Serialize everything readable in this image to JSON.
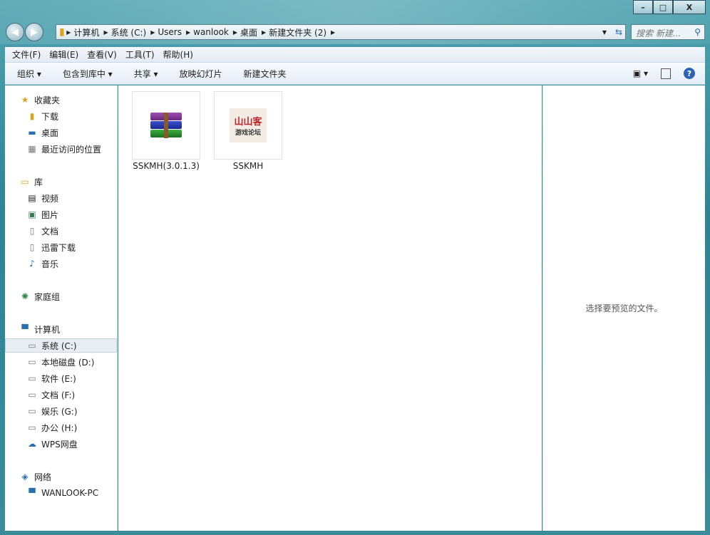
{
  "window": {
    "minimize": "–",
    "maximize": "□",
    "close": "X"
  },
  "address": {
    "segments": [
      "计算机",
      "系统 (C:)",
      "Users",
      "wanlook",
      "桌面",
      "新建文件夹 (2)"
    ]
  },
  "search": {
    "placeholder": "搜索 新建..."
  },
  "menu": [
    "文件(F)",
    "编辑(E)",
    "查看(V)",
    "工具(T)",
    "帮助(H)"
  ],
  "toolbar": {
    "organize": "组织 ▾",
    "include": "包含到库中 ▾",
    "share": "共享 ▾",
    "slideshow": "放映幻灯片",
    "new_folder": "新建文件夹",
    "help": "?"
  },
  "sidebar": {
    "favorites": {
      "label": "收藏夹",
      "items": [
        "下载",
        "桌面",
        "最近访问的位置"
      ]
    },
    "libraries": {
      "label": "库",
      "items": [
        "视频",
        "图片",
        "文档",
        "迅雷下载",
        "音乐"
      ]
    },
    "homegroup": "家庭组",
    "computer": {
      "label": "计算机",
      "items": [
        "系统 (C:)",
        "本地磁盘 (D:)",
        "软件 (E:)",
        "文档 (F:)",
        "娱乐 (G:)",
        "办公 (H:)",
        "WPS网盘"
      ]
    },
    "network": {
      "label": "网络",
      "items": [
        "WANLOOK-PC"
      ]
    }
  },
  "files": [
    {
      "name": "SSKMH(3.0.1.3)",
      "type": "rar"
    },
    {
      "name": "SSKMH",
      "type": "logo",
      "logo_text": [
        "山山客",
        "游戏论坛"
      ]
    }
  ],
  "preview": {
    "text": "选择要预览的文件。"
  }
}
